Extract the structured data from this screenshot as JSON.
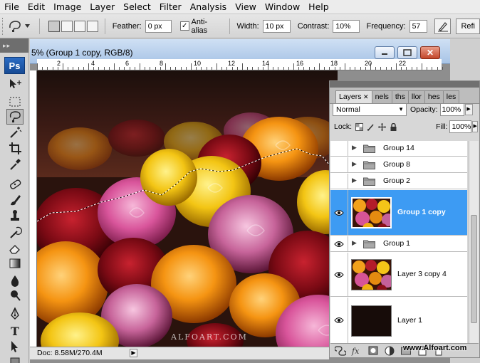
{
  "menu": [
    "File",
    "Edit",
    "Image",
    "Layer",
    "Select",
    "Filter",
    "Analysis",
    "View",
    "Window",
    "Help"
  ],
  "options": {
    "feather_label": "Feather:",
    "feather_value": "0 px",
    "antialias_label": "Anti-alias",
    "antialias_checked": true,
    "width_label": "Width:",
    "width_value": "10 px",
    "contrast_label": "Contrast:",
    "contrast_value": "10%",
    "frequency_label": "Frequency:",
    "frequency_value": "57",
    "refine_label": "Refi"
  },
  "tools": {
    "logo": "Ps",
    "icons": [
      "move-tool-icon",
      "marquee-tool-icon",
      "magnetic-lasso-tool-icon",
      "magic-wand-tool-icon",
      "crop-tool-icon",
      "eyedropper-tool-icon",
      "healing-brush-icon",
      "brush-tool-icon",
      "clone-stamp-icon",
      "history-brush-icon",
      "eraser-tool-icon",
      "gradient-tool-icon",
      "blur-tool-icon",
      "dodge-tool-icon",
      "pen-tool-icon",
      "type-tool-icon",
      "path-selection-icon",
      "shape-tool-icon"
    ],
    "active": "magnetic-lasso-tool-icon"
  },
  "document": {
    "title": "5% (Group 1 copy, RGB/8)",
    "ruler_labels": [
      "2",
      "4",
      "6",
      "8",
      "10",
      "12",
      "14",
      "16",
      "18",
      "20",
      "22"
    ],
    "status": "Doc: 8.58M/270.4M",
    "watermark": "ALFOART.COM"
  },
  "layers_panel": {
    "tabs": [
      "Layers",
      "nels",
      "ths",
      "llor",
      "hes",
      "les"
    ],
    "blend_mode": "Normal",
    "opacity_label": "Opacity:",
    "opacity_value": "100%",
    "lock_label": "Lock:",
    "fill_label": "Fill:",
    "fill_value": "100%",
    "layers": [
      {
        "name": "Group 14",
        "type": "group",
        "visible": false,
        "selected": false
      },
      {
        "name": "Group 8",
        "type": "group",
        "visible": false,
        "selected": false
      },
      {
        "name": "Group 2",
        "type": "group",
        "visible": false,
        "selected": false
      },
      {
        "name": "Group 1 copy",
        "type": "image",
        "visible": true,
        "selected": true
      },
      {
        "name": "Group 1",
        "type": "group",
        "visible": true,
        "selected": false
      },
      {
        "name": "Layer 3 copy 4",
        "type": "image",
        "visible": true,
        "selected": false
      },
      {
        "name": "Layer 1",
        "type": "dark",
        "visible": true,
        "selected": false
      }
    ],
    "footer_icons": [
      "link-layers-icon",
      "layer-style-icon",
      "layer-mask-icon",
      "adjustment-layer-icon",
      "new-group-icon",
      "new-layer-icon",
      "delete-layer-icon"
    ]
  },
  "site_watermark": "www.Alfoart.com",
  "colors": {
    "selection": "#3d9bf3",
    "title_bar": "#b8d0ee",
    "close_button": "#c3472b"
  }
}
